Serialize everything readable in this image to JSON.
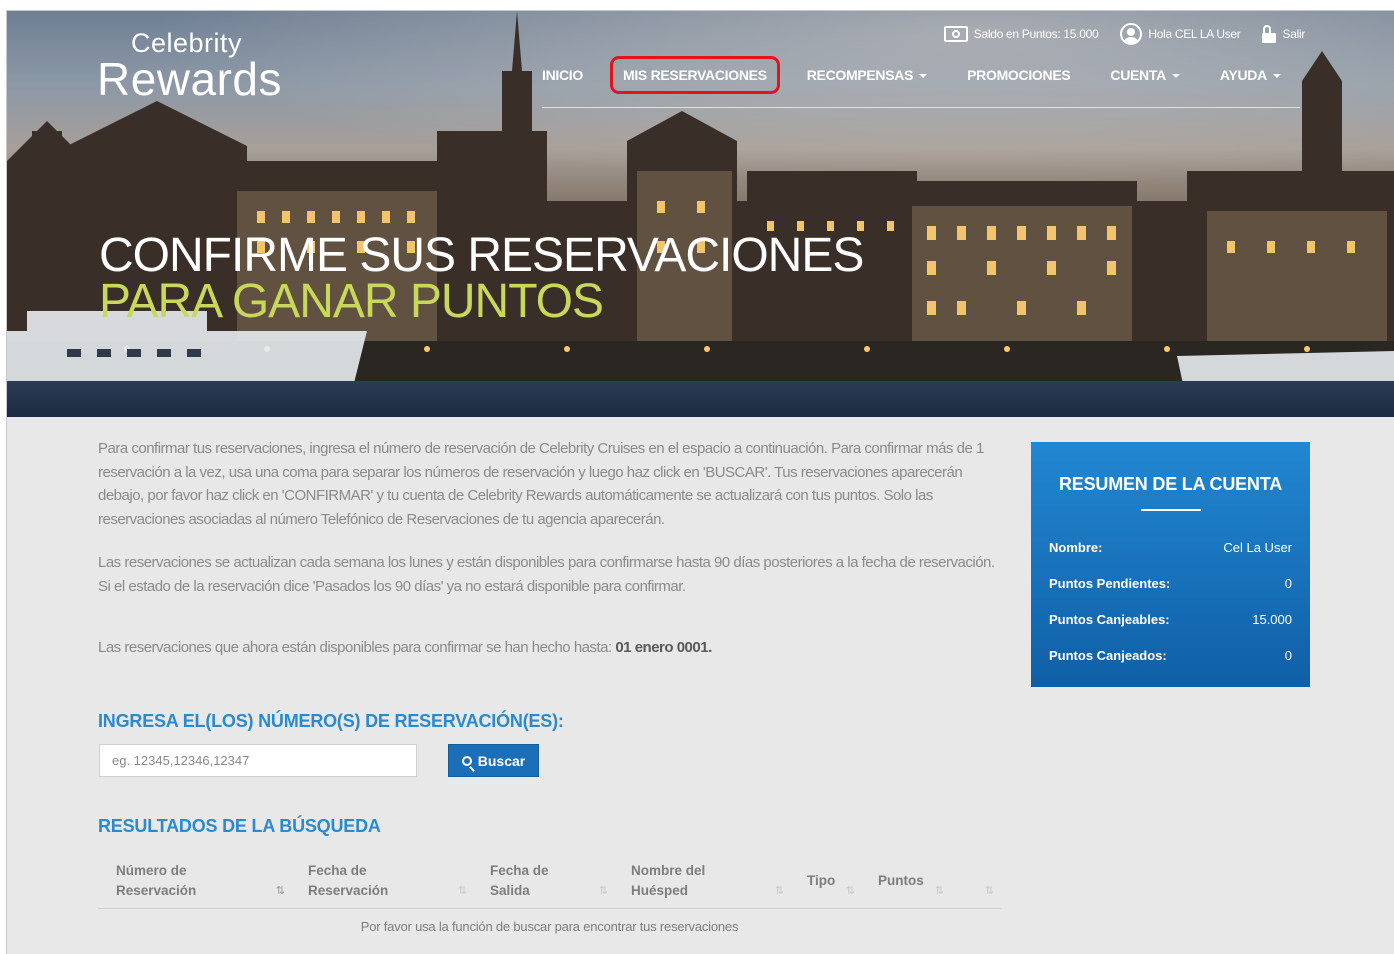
{
  "brand": {
    "line1": "Celebrity",
    "line2": "Rewards"
  },
  "topbar": {
    "points": "Saldo en Puntos: 15.000",
    "greeting": "Hola CEL LA User",
    "logout": "Salir"
  },
  "nav": {
    "items": [
      "INICIO",
      "MIS RESERVACIONES",
      "RECOMPENSAS",
      "PROMOCIONES",
      "CUENTA",
      "AYUDA"
    ],
    "active_highlight_color": "#e1141a"
  },
  "hero": {
    "title_line1": "CONFIRME SUS RESERVACIONES",
    "title_line2": "PARA GANAR PUNTOS"
  },
  "intro": {
    "p1": "Para confirmar tus reservaciones, ingresa el número de reservación de Celebrity Cruises en el espacio a continuación. Para confirmar más de 1 reservación a la vez, usa una coma para separar los números de reservación y luego haz click en 'BUSCAR'. Tus reservaciones aparecerán debajo, por favor haz click en 'CONFIRMAR' y tu cuenta de Celebrity Rewards automáticamente se actualizará con tus puntos. Solo las reservaciones asociadas al número Telefónico de Reservaciones de tu agencia aparecerán.",
    "p2": "Las reservaciones se actualizan cada semana los lunes y están disponibles para confirmarse hasta 90 días posteriores a la fecha de reservación. Si el estado de la reservación dice 'Pasados los 90 días' ya no estará disponible para confirmar.",
    "p3_prefix": "Las reservaciones que ahora están disponibles para confirmar se han hecho hasta: ",
    "p3_date": "01 enero 0001."
  },
  "summary": {
    "title": "RESUMEN DE LA CUENTA",
    "rows": [
      {
        "label": "Nombre:",
        "value": "Cel La User"
      },
      {
        "label": "Puntos Pendientes:",
        "value": "0"
      },
      {
        "label": "Puntos Canjeables:",
        "value": "15.000"
      },
      {
        "label": "Puntos Canjeados:",
        "value": "0"
      }
    ]
  },
  "search": {
    "heading": "INGRESA EL(LOS) NÚMERO(S) DE RESERVACIÓN(ES):",
    "placeholder": "eg. 12345,12346,12347",
    "button": "Buscar"
  },
  "results": {
    "heading": "RESULTADOS DE LA BÚSQUEDA",
    "columns": [
      {
        "l1": "Número de",
        "l2": "Reservación"
      },
      {
        "l1": "Fecha de",
        "l2": "Reservación"
      },
      {
        "l1": "Fecha de",
        "l2": "Salida"
      },
      {
        "l1": "Nombre del",
        "l2": "Huésped"
      },
      {
        "l1": "Tipo",
        "l2": ""
      },
      {
        "l1": "Puntos",
        "l2": ""
      }
    ],
    "empty_message": "Por favor usa la función de buscar para encontrar tus reservaciones"
  },
  "colors": {
    "accent": "#2a8ad0",
    "summary_bg": "#1a73be",
    "hero_title_green": "#c8d85a"
  }
}
